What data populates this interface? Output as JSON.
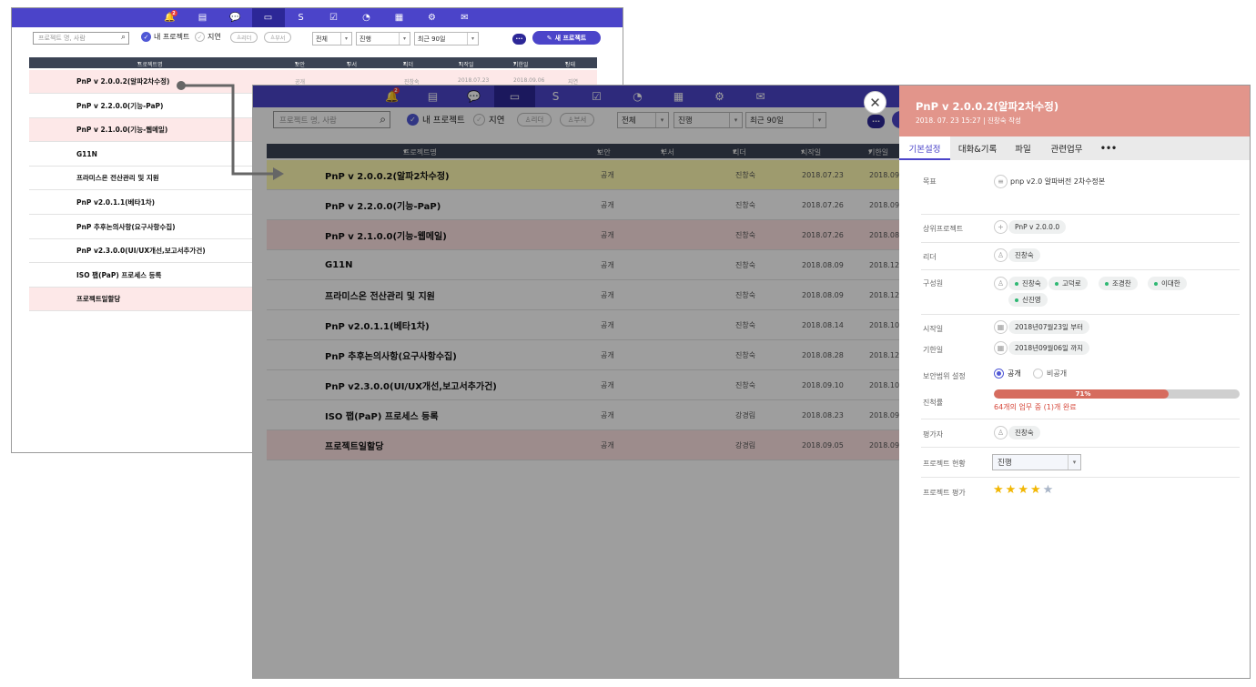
{
  "nav_icons": [
    "bell-icon",
    "list-icon",
    "chat-icon",
    "folder-icon",
    "flow-icon",
    "check-icon",
    "pie-icon",
    "calendar-icon",
    "gear-icon",
    "mail-icon"
  ],
  "nav_badge": "2",
  "toolbar": {
    "search_placeholder": "프로젝트 명, 사람",
    "my_project": "내 프로젝트",
    "delayed": "지연",
    "leader_btn": "리더",
    "dept_btn": "부서",
    "select_all": "전체",
    "select_status": "진행",
    "select_period": "최근 90일",
    "new_project": "새 프로젝트"
  },
  "columns": {
    "name": "프로젝트명",
    "security": "보안",
    "dept": "부서",
    "leader": "리더",
    "start": "시작일",
    "due": "기한일",
    "status": "상태"
  },
  "back_first_row": {
    "security": "공개",
    "leader": "진창숙",
    "start": "2018.07.23",
    "due": "2018.09.06",
    "status": "지연"
  },
  "projects": [
    {
      "name": "PnP v 2.0.0.2(알파2차수정)",
      "security": "공개",
      "leader": "진창숙",
      "start": "2018.07.23",
      "due": "2018.09.0",
      "highlight": "yellow"
    },
    {
      "name": "PnP v 2.2.0.0(기능-PaP)",
      "security": "공개",
      "leader": "진창숙",
      "start": "2018.07.26",
      "due": "2018.09.",
      "highlight": "none"
    },
    {
      "name": "PnP v 2.1.0.0(기능-웹메일)",
      "security": "공개",
      "leader": "진창숙",
      "start": "2018.07.26",
      "due": "2018.08.",
      "highlight": "pink"
    },
    {
      "name": "G11N",
      "security": "공개",
      "leader": "진창숙",
      "start": "2018.08.09",
      "due": "2018.12.",
      "highlight": "none"
    },
    {
      "name": "프라미스온 전산관리 및 지원",
      "security": "공개",
      "leader": "진창숙",
      "start": "2018.08.09",
      "due": "2018.12.",
      "highlight": "none"
    },
    {
      "name": "PnP v2.0.1.1(베타1차)",
      "security": "공개",
      "leader": "진창숙",
      "start": "2018.08.14",
      "due": "2018.10.",
      "highlight": "none"
    },
    {
      "name": "PnP 추후논의사항(요구사항수집)",
      "security": "공개",
      "leader": "진창숙",
      "start": "2018.08.28",
      "due": "2018.12.",
      "highlight": "none"
    },
    {
      "name": "PnP v2.3.0.0(UI/UX개선,보고서추가건)",
      "security": "공개",
      "leader": "진창숙",
      "start": "2018.09.10",
      "due": "2018.10.",
      "highlight": "none"
    },
    {
      "name": "ISO 팹(PaP) 프로세스 등록",
      "security": "공개",
      "leader": "강경림",
      "start": "2018.08.23",
      "due": "2018.09.",
      "highlight": "none"
    },
    {
      "name": "프로젝트일할당",
      "security": "공개",
      "leader": "강경림",
      "start": "2018.09.05",
      "due": "2018.09.0",
      "highlight": "pink"
    }
  ],
  "back_projects": [
    {
      "name": "PnP v 2.0.0.2(알파2차수정)",
      "highlight": "pink"
    },
    {
      "name": "PnP v 2.2.0.0(기능-PaP)",
      "highlight": "none"
    },
    {
      "name": "PnP v 2.1.0.0(기능-웹메일)",
      "highlight": "pink"
    },
    {
      "name": "G11N",
      "highlight": "none"
    },
    {
      "name": "프라미스온 전산관리 및 지원",
      "highlight": "none"
    },
    {
      "name": "PnP v2.0.1.1(베타1차)",
      "highlight": "none"
    },
    {
      "name": "PnP 추후논의사항(요구사항수집)",
      "highlight": "none"
    },
    {
      "name": "PnP v2.3.0.0(UI/UX개선,보고서추가건)",
      "highlight": "none"
    },
    {
      "name": "ISO 팹(PaP) 프로세스 등록",
      "highlight": "none"
    },
    {
      "name": "프로젝트일할당",
      "highlight": "pink"
    }
  ],
  "panel": {
    "title": "PnP v 2.0.0.2(알파2차수정)",
    "subtitle": "2018. 07. 23 15:27 | 진창숙 작성",
    "tabs": [
      "기본설정",
      "대화&기록",
      "파일",
      "관련업무",
      "•••"
    ],
    "goal_label": "목표",
    "goal_value": "pnp v2.0 알파버전 2차수정본",
    "parent_label": "상위프로젝트",
    "parent_value": "PnP v 2.0.0.0",
    "leader_label": "리더",
    "leader_value": "진창숙",
    "members_label": "구성원",
    "members": [
      "진창숙",
      "고덕로",
      "조경찬",
      "이대한",
      "신진영"
    ],
    "start_label": "시작일",
    "start_value": "2018년07월23일 부터",
    "due_label": "기한일",
    "due_value": "2018년09월06일 까지",
    "security_label": "보안범위 설정",
    "security_public": "공개",
    "security_private": "비공개",
    "progress_label": "진척률",
    "progress_percent": 71,
    "progress_text": "71%",
    "progress_note": "64개의 업무 중 (1)개 완료",
    "evaluator_label": "평가자",
    "evaluator_value": "진창숙",
    "status_label": "프로젝트 현황",
    "status_value": "진행",
    "rating_label": "프로젝트 평가",
    "rating": 4,
    "rating_max": 5
  },
  "colors": {
    "nav": "#4b44c9",
    "header": "#3b4354",
    "title_bar": "#e2958b",
    "progress": "#d66c5e",
    "star": "#f2b705"
  }
}
